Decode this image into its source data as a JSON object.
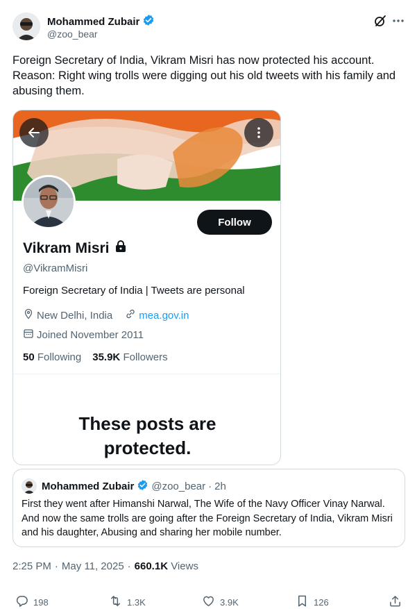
{
  "author": {
    "name": "Mohammed Zubair",
    "handle": "@zoo_bear",
    "verified": true
  },
  "tweet": {
    "text": "Foreign Secretary of India, Vikram Misri has now protected his account. Reason: Right wing trolls were digging out his old tweets with his family and abusing them."
  },
  "media": {
    "profile_name": "Vikram Misri",
    "profile_handle": "@VikramMisri",
    "bio": "Foreign Secretary of India | Tweets are personal",
    "location": "New Delhi, India",
    "website": "mea.gov.in",
    "joined": "Joined November 2011",
    "following_count": "50",
    "following_label": "Following",
    "followers_count": "35.9K",
    "followers_label": "Followers",
    "follow_label": "Follow",
    "protected_line1": "These posts are",
    "protected_line2": "protected."
  },
  "quote": {
    "name": "Mohammed Zubair",
    "handle": "@zoo_bear",
    "time": "2h",
    "text": "First they went after Himanshi Narwal, The Wife of the Navy Officer Vinay Narwal. And now the same trolls are going after the Foreign Secretary of India, Vikram Misri and his daughter, Abusing and sharing her mobile number."
  },
  "meta": {
    "time": "2:25 PM",
    "date": "May 11, 2025",
    "views_count": "660.1K",
    "views_label": "Views"
  },
  "actions": {
    "replies": "198",
    "reposts": "1.3K",
    "likes": "3.9K",
    "bookmarks": "126"
  },
  "colors": {
    "accent": "#1d9bf0",
    "text": "#0f1419",
    "muted": "#536471",
    "border": "#cfd9de"
  },
  "icons": [
    "verified-badge-icon",
    "grok-icon",
    "more-icon",
    "back-arrow-icon",
    "kebab-icon",
    "lock-icon",
    "location-icon",
    "link-icon",
    "calendar-icon",
    "reply-icon",
    "repost-icon",
    "like-icon",
    "bookmark-icon",
    "share-icon"
  ]
}
